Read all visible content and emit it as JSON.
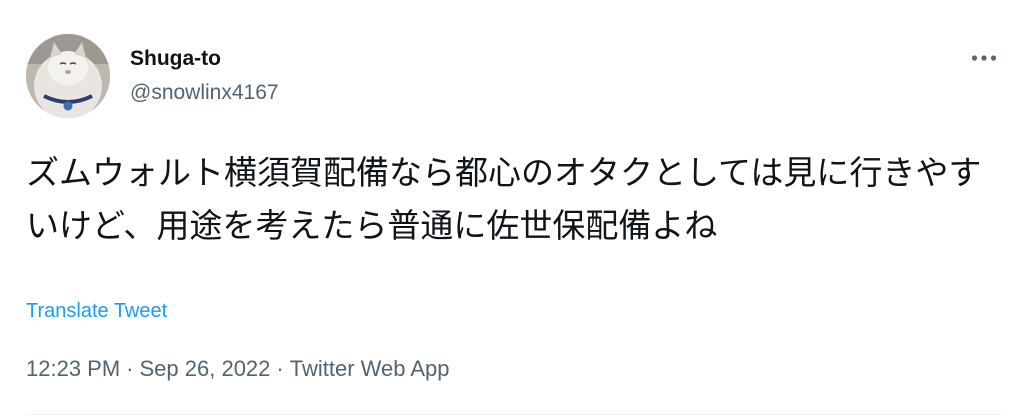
{
  "author": {
    "display_name": "Shuga-to",
    "handle": "@snowlinx4167",
    "avatar_icon": "cat-avatar"
  },
  "menu": {
    "more_icon": "ellipsis-icon"
  },
  "tweet": {
    "text": "ズムウォルト横須賀配備なら都心のオタクとしては見に行きやすいけど、用途を考えたら普通に佐世保配備よね",
    "translate_label": "Translate Tweet"
  },
  "meta": {
    "time": "12:23 PM",
    "separator": "·",
    "date": "Sep 26, 2022",
    "source": "Twitter Web App"
  },
  "colors": {
    "text": "#0f1419",
    "secondary": "#536471",
    "link": "#1d9bf0",
    "divider": "#eff3f4"
  }
}
